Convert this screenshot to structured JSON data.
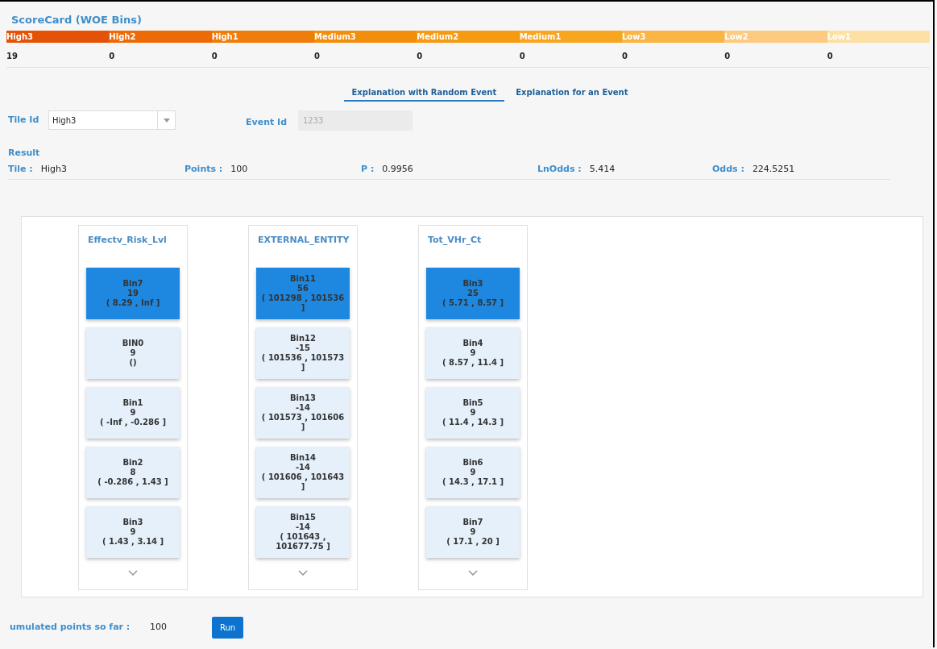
{
  "title": "ScoreCard (WOE Bins)",
  "tiles": [
    {
      "label": "High3",
      "count": "19",
      "color": "#e35205"
    },
    {
      "label": "High2",
      "count": "0",
      "color": "#ec6a08"
    },
    {
      "label": "High1",
      "count": "0",
      "color": "#f07d0a"
    },
    {
      "label": "Medium3",
      "count": "0",
      "color": "#f38d0c"
    },
    {
      "label": "Medium2",
      "count": "0",
      "color": "#f69a12"
    },
    {
      "label": "Medium1",
      "count": "0",
      "color": "#f8a520"
    },
    {
      "label": "Low3",
      "count": "0",
      "color": "#fab544"
    },
    {
      "label": "Low2",
      "count": "0",
      "color": "#fcca80"
    },
    {
      "label": "Low1",
      "count": "0",
      "color": "#fde0a4"
    }
  ],
  "tabs": [
    {
      "label": "Explanation with Random Event",
      "selected": true
    },
    {
      "label": "Explanation for an Event",
      "selected": false
    }
  ],
  "tile_id": {
    "label": "Tile Id",
    "value": "High3"
  },
  "event_id": {
    "label": "Event Id",
    "value": "1233",
    "disabled": true
  },
  "result": {
    "heading": "Result",
    "fields": [
      {
        "label": "Tile :",
        "value": "High3"
      },
      {
        "label": "Points :",
        "value": "100"
      },
      {
        "label": "P :",
        "value": "0.9956"
      },
      {
        "label": "LnOdds :",
        "value": "5.414"
      },
      {
        "label": "Odds :",
        "value": "224.5251"
      }
    ]
  },
  "variables": [
    {
      "name": "Effectv_Risk_Lvl",
      "bins": [
        {
          "name": "Bin7",
          "points": "19",
          "range": "( 8.29 , Inf ]",
          "selected": true
        },
        {
          "name": "BIN0",
          "points": "9",
          "range": "()",
          "selected": false
        },
        {
          "name": "Bin1",
          "points": "9",
          "range": "( -Inf , -0.286 ]",
          "selected": false
        },
        {
          "name": "Bin2",
          "points": "8",
          "range": "( -0.286 , 1.43 ]",
          "selected": false
        },
        {
          "name": "Bin3",
          "points": "9",
          "range": "( 1.43 , 3.14 ]",
          "selected": false
        }
      ]
    },
    {
      "name": "EXTERNAL_ENTITY",
      "bins": [
        {
          "name": "Bin11",
          "points": "56",
          "range": "( 101298 , 101536 ]",
          "selected": true
        },
        {
          "name": "Bin12",
          "points": "-15",
          "range": "( 101536 , 101573 ]",
          "selected": false
        },
        {
          "name": "Bin13",
          "points": "-14",
          "range": "( 101573 , 101606 ]",
          "selected": false
        },
        {
          "name": "Bin14",
          "points": "-14",
          "range": "( 101606 , 101643 ]",
          "selected": false
        },
        {
          "name": "Bin15",
          "points": "-14",
          "range": "( 101643 , 101677.75 ]",
          "selected": false
        }
      ]
    },
    {
      "name": "Tot_VHr_Ct",
      "bins": [
        {
          "name": "Bin3",
          "points": "25",
          "range": "( 5.71 , 8.57 ]",
          "selected": true
        },
        {
          "name": "Bin4",
          "points": "9",
          "range": "( 8.57 , 11.4 ]",
          "selected": false
        },
        {
          "name": "Bin5",
          "points": "9",
          "range": "( 11.4 , 14.3 ]",
          "selected": false
        },
        {
          "name": "Bin6",
          "points": "9",
          "range": "( 14.3 , 17.1 ]",
          "selected": false
        },
        {
          "name": "Bin7",
          "points": "9",
          "range": "( 17.1 , 20 ]",
          "selected": false
        }
      ]
    }
  ],
  "footer": {
    "label": "umulated points so far :",
    "value": "100",
    "button": "Run"
  }
}
